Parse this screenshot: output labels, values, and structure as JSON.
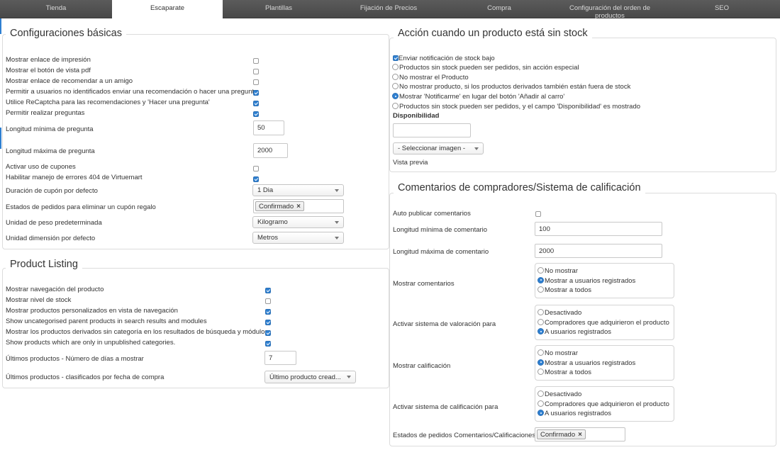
{
  "tabs": [
    {
      "label": "Tienda"
    },
    {
      "label": "Escaparate"
    },
    {
      "label": "Plantillas"
    },
    {
      "label": "Fijación de Precios"
    },
    {
      "label": "Compra"
    },
    {
      "label": "Configuración del orden de productos"
    },
    {
      "label": "SEO"
    }
  ],
  "active_tab": "Escaparate",
  "basic": {
    "title": "Configuraciones básicas",
    "checks": [
      {
        "label": "Mostrar enlace de impresión",
        "checked": false
      },
      {
        "label": "Mostrar el botón de vista pdf",
        "checked": false
      },
      {
        "label": "Mostrar enlace de recomendar a un amigo",
        "checked": false
      },
      {
        "label": "Permitir a usuarios no identificados enviar una recomendación o hacer una pregunta",
        "checked": true
      },
      {
        "label": "Utilice ReCaptcha para las recomendaciones y 'Hacer una pregunta'",
        "checked": true
      },
      {
        "label": "Permitir realizar preguntas",
        "checked": true
      }
    ],
    "min_question_label": "Longitud mínima de pregunta",
    "min_question_value": "50",
    "max_question_label": "Longitud máxima de pregunta",
    "max_question_value": "2000",
    "coupons_label": "Activar uso de cupones",
    "coupons_checked": false,
    "errors404_label": "Habilitar manejo de errores 404 de Virtuemart",
    "errors404_checked": true,
    "coupon_duration_label": "Duración de cupón por defecto",
    "coupon_duration_value": "1 Dia",
    "coupon_states_label": "Estados de pedidos para eliminar un cupón regalo",
    "coupon_states_tag": "Confirmado",
    "weight_label": "Unidad de peso predeterminada",
    "weight_value": "Kilogramo",
    "dimension_label": "Unidad dimensión por defecto",
    "dimension_value": "Metros"
  },
  "listing": {
    "title": "Product Listing",
    "checks": [
      {
        "label": "Mostrar navegación del producto",
        "checked": true
      },
      {
        "label": "Mostrar nivel de stock",
        "checked": false
      },
      {
        "label": "Mostrar productos personalizados en vista de navegación",
        "checked": true
      },
      {
        "label": "Show uncategorised parent products in search results and modules",
        "checked": true
      },
      {
        "label": "Mostrar los productos derivados sin categoría en los resultados de búsqueda y módulos",
        "checked": true
      },
      {
        "label": "Show products which are only in unpublished categories.",
        "checked": true
      }
    ],
    "days_label": "Últimos productos - Número de días a mostrar",
    "days_value": "7",
    "sorted_label": "Últimos productos - clasificados por fecha de compra",
    "sorted_value": "Último producto cread..."
  },
  "stock": {
    "title": "Acción cuando un producto está sin stock",
    "notify_label": "Enviar notificación de stock bajo",
    "notify_checked": true,
    "options": [
      {
        "label": "Productos sin stock pueden ser pedidos, sin acción especial",
        "selected": false
      },
      {
        "label": "No mostrar el Producto",
        "selected": false
      },
      {
        "label": "No mostrar producto, si los productos derivados también están fuera de stock",
        "selected": false
      },
      {
        "label": "Mostrar 'Notificarme' en lugar del botón 'Añadir al carro'",
        "selected": true
      },
      {
        "label": "Productos sin stock pueden ser pedidos, y el campo 'Disponibilidad' es mostrado",
        "selected": false
      }
    ],
    "availability_label": "Disponibilidad",
    "availability_value": "",
    "image_select": "- Seleccionar imagen -",
    "preview_label": "Vista previa"
  },
  "reviews": {
    "title": "Comentarios de compradores/Sistema de calificación",
    "auto_publish_label": "Auto publicar comentarios",
    "auto_publish_checked": false,
    "min_comment_label": "Longitud mínima de comentario",
    "min_comment_value": "100",
    "max_comment_label": "Longitud máxima de comentario",
    "max_comment_value": "2000",
    "groups": [
      {
        "label": "Mostrar comentarios",
        "options": [
          {
            "label": "No mostrar",
            "selected": false
          },
          {
            "label": "Mostrar a usuarios registrados",
            "selected": true
          },
          {
            "label": "Mostrar a todos",
            "selected": false
          }
        ]
      },
      {
        "label": "Activar sistema de valoración para",
        "options": [
          {
            "label": "Desactivado",
            "selected": false
          },
          {
            "label": "Compradores que adquirieron el producto",
            "selected": false
          },
          {
            "label": "A usuarios registrados",
            "selected": true
          }
        ]
      },
      {
        "label": "Mostrar calificación",
        "options": [
          {
            "label": "No mostrar",
            "selected": false
          },
          {
            "label": "Mostrar a usuarios registrados",
            "selected": true
          },
          {
            "label": "Mostrar a todos",
            "selected": false
          }
        ]
      },
      {
        "label": "Activar sistema de calificación para",
        "options": [
          {
            "label": "Desactivado",
            "selected": false
          },
          {
            "label": "Compradores que adquirieron el producto",
            "selected": false
          },
          {
            "label": "A usuarios registrados",
            "selected": true
          }
        ]
      }
    ],
    "states_label": "Estados de pedidos Comentarios/Calificaciones",
    "states_tag": "Confirmado"
  },
  "colors": {
    "accent": "#2f80d1",
    "tabbar": "#4f4f4f"
  }
}
